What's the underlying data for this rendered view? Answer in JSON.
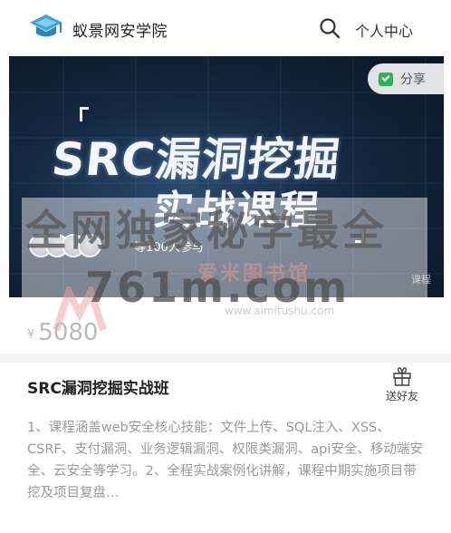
{
  "header": {
    "site_name": "蚁景网安学院",
    "user_center_label": "个人中心",
    "logo_icon": "graduation-cap-icon",
    "search_icon": "search-icon"
  },
  "banner": {
    "title_line1": "SRC漏洞挖掘",
    "title_line2": "实战课程",
    "share_label": "分享",
    "learners_text": "等100人参与",
    "course_tag": "课程",
    "share_icon": "share-check-icon",
    "avatar_count": 4
  },
  "watermark": {
    "line1": "全网独家秘学最全",
    "line2": "爱米图书馆",
    "line3": "761m.com",
    "url": "www.aimitushu.com"
  },
  "price": {
    "currency": "¥",
    "amount": "5080"
  },
  "course": {
    "title": "SRC漏洞挖掘实战班",
    "gift_label": "送好友",
    "gift_icon": "gift-icon",
    "description": "1、课程涵盖web安全核心技能：文件上传、SQL注入、XSS、CSRF、支付漏洞、业务逻辑漏洞、权限类漏洞、api安全、移动端安全、云安全等学习。2、全程实战案例化讲解，课程中期实施项目带挖及项目复盘…"
  },
  "colors": {
    "banner_dark": "#14283f",
    "share_green": "#2fb15a",
    "price_gray": "#bbbbbb",
    "desc_gray": "#9a9a9a"
  }
}
